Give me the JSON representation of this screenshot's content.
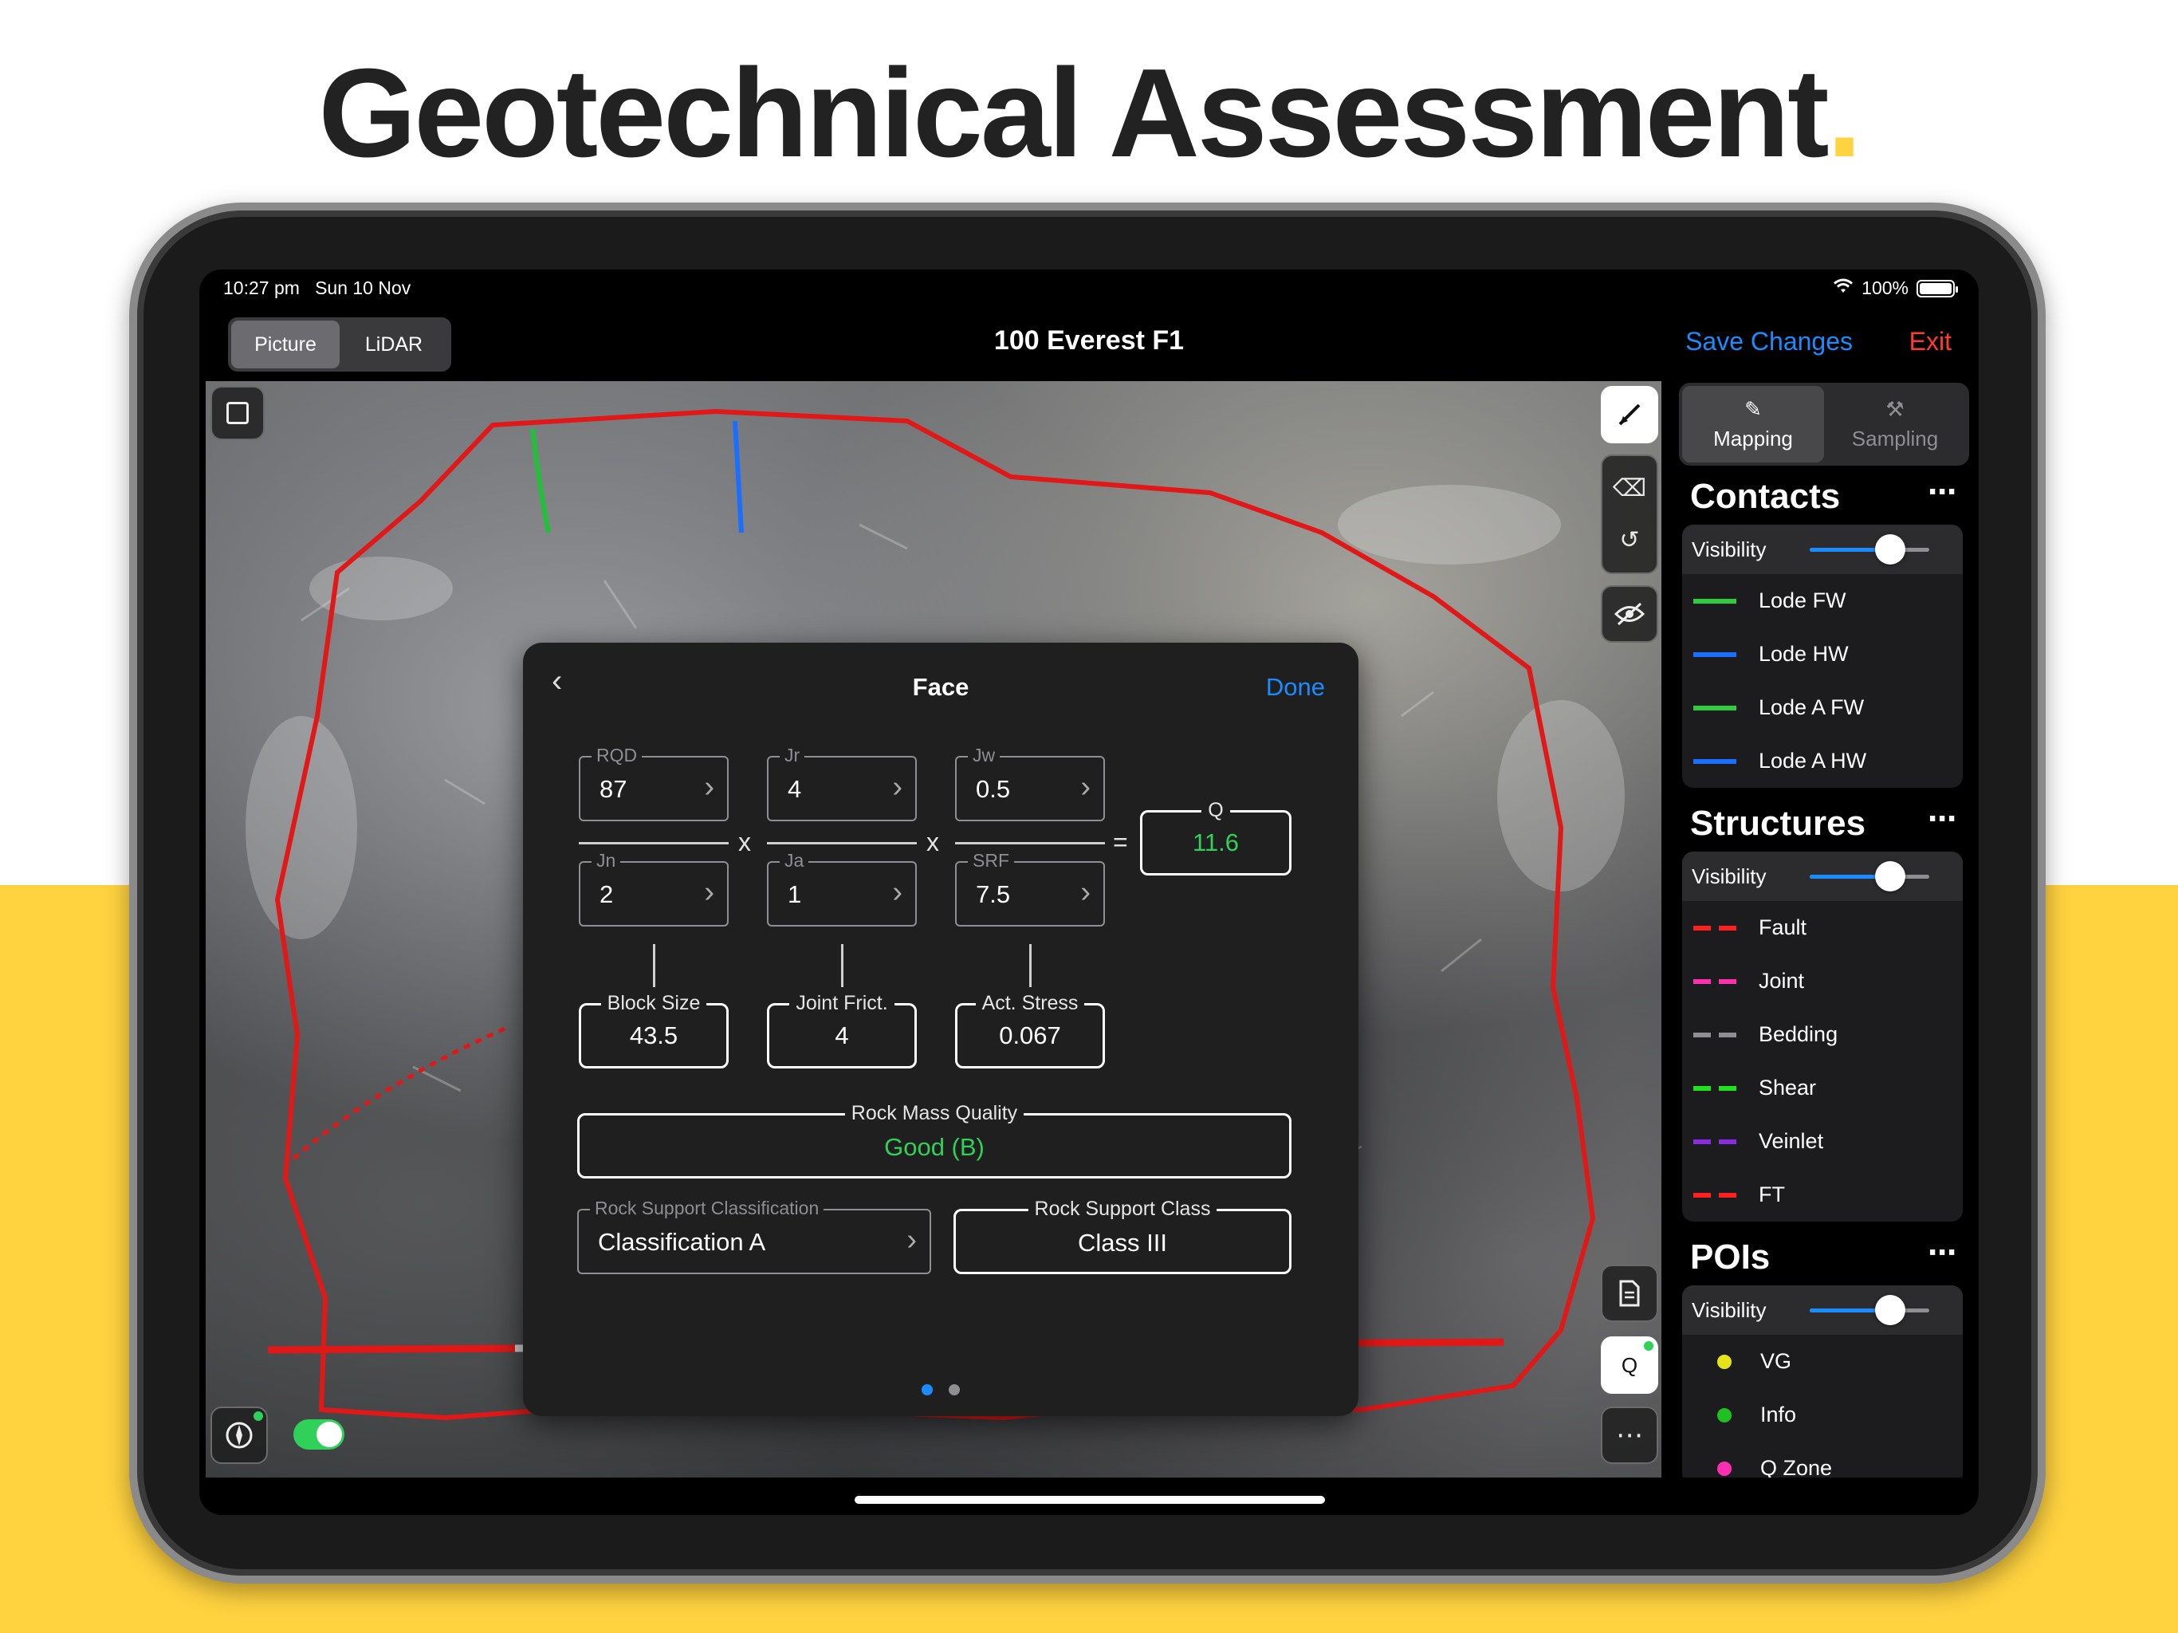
{
  "headline": {
    "text": "Geotechnical Assessment",
    "dot": ".",
    "accent": "#FFD23F"
  },
  "status": {
    "time": "10:27 pm",
    "date": "Sun 10 Nov",
    "battery": "100%"
  },
  "nav": {
    "segments": [
      "Picture",
      "LiDAR"
    ],
    "selected_segment": "Picture",
    "title": "100 Everest F1",
    "save_label": "Save Changes",
    "exit_label": "Exit"
  },
  "tools": {
    "q_label": "Q",
    "more": "⋯"
  },
  "modal": {
    "back": "‹",
    "title": "Face",
    "done": "Done",
    "fields": {
      "rqd": {
        "label": "RQD",
        "value": "87"
      },
      "jr": {
        "label": "Jr",
        "value": "4"
      },
      "jw": {
        "label": "Jw",
        "value": "0.5"
      },
      "jn": {
        "label": "Jn",
        "value": "2"
      },
      "ja": {
        "label": "Ja",
        "value": "1"
      },
      "srf": {
        "label": "SRF",
        "value": "7.5"
      }
    },
    "ops": {
      "times": "x",
      "equals": "="
    },
    "q": {
      "label": "Q",
      "value": "11.6"
    },
    "block_size": {
      "label": "Block Size",
      "value": "43.5"
    },
    "joint_frict": {
      "label": "Joint Frict.",
      "value": "4"
    },
    "act_stress": {
      "label": "Act. Stress",
      "value": "0.067"
    },
    "rock_mass_quality": {
      "label": "Rock Mass Quality",
      "value": "Good (B)"
    },
    "rock_support_classification": {
      "label": "Rock Support Classification",
      "value": "Classification A"
    },
    "rock_support_class": {
      "label": "Rock Support Class",
      "value": "Class III"
    },
    "chevron": "›",
    "page_index": 1,
    "page_count": 2,
    "accent_green": "#30d158"
  },
  "panel": {
    "tabs": [
      {
        "label": "Mapping",
        "icon": "pencil-icon"
      },
      {
        "label": "Sampling",
        "icon": "hammer-icon"
      }
    ],
    "more": "⋯",
    "visibility_label": "Visibility",
    "contacts": {
      "title": "Contacts",
      "visibility": 0.67,
      "items": [
        {
          "label": "Lode FW",
          "color": "#2ecc40"
        },
        {
          "label": "Lode HW",
          "color": "#1a6fff"
        },
        {
          "label": "Lode A FW",
          "color": "#2ecc40"
        },
        {
          "label": "Lode A HW",
          "color": "#1a6fff"
        }
      ]
    },
    "structures": {
      "title": "Structures",
      "visibility": 0.67,
      "items": [
        {
          "label": "Fault",
          "color": "#ff2020"
        },
        {
          "label": "Joint",
          "color": "#ff2fb0"
        },
        {
          "label": "Bedding",
          "color": "#8e8e93"
        },
        {
          "label": "Shear",
          "color": "#20e020"
        },
        {
          "label": "Veinlet",
          "color": "#8a2be2"
        },
        {
          "label": "FT",
          "color": "#ff2020"
        }
      ]
    },
    "pois": {
      "title": "POIs",
      "visibility": 0.67,
      "items": [
        {
          "label": "VG",
          "color": "#e5e51a"
        },
        {
          "label": "Info",
          "color": "#20c020"
        },
        {
          "label": "Q Zone",
          "color": "#ff2fb0"
        }
      ]
    }
  }
}
